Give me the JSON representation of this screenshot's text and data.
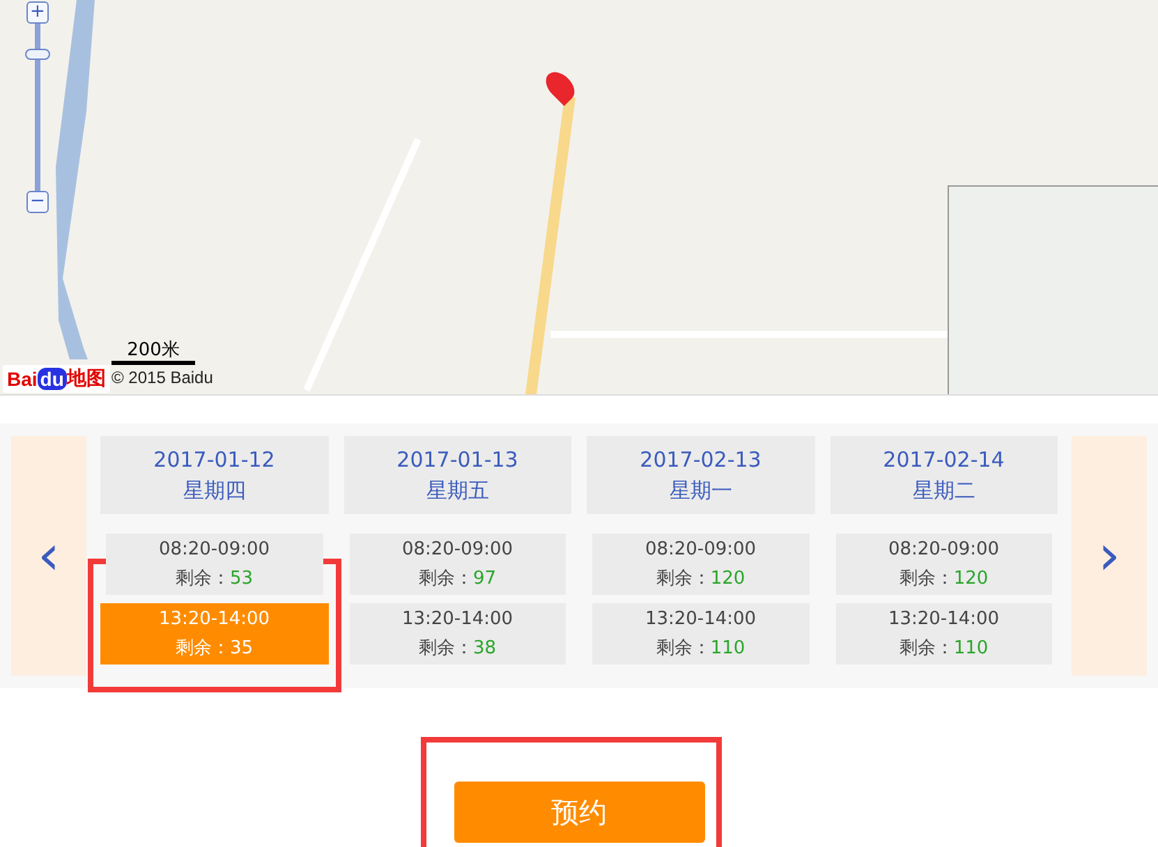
{
  "map": {
    "zoom": {
      "level": 0.85
    },
    "zoom_in": "+",
    "zoom_out": "−",
    "scale": "200米",
    "copyright": "© 2015 Baidu",
    "logo": {
      "left": "Bai",
      "mid": "du",
      "right": "地图"
    }
  },
  "schedule": {
    "prev": "‹",
    "next": "›",
    "days": [
      {
        "date": "2017-01-12",
        "weekday": "星期四",
        "slots": [
          {
            "time": "08:20-09:00",
            "remaining_label": "剩余：",
            "remaining": "53",
            "selected": false
          },
          {
            "time": "13:20-14:00",
            "remaining_label": "剩余：",
            "remaining": "35",
            "selected": true
          }
        ]
      },
      {
        "date": "2017-01-13",
        "weekday": "星期五",
        "slots": [
          {
            "time": "08:20-09:00",
            "remaining_label": "剩余：",
            "remaining": "97",
            "selected": false
          },
          {
            "time": "13:20-14:00",
            "remaining_label": "剩余：",
            "remaining": "38",
            "selected": false
          }
        ]
      },
      {
        "date": "2017-02-13",
        "weekday": "星期一",
        "slots": [
          {
            "time": "08:20-09:00",
            "remaining_label": "剩余：",
            "remaining": "120",
            "selected": false
          },
          {
            "time": "13:20-14:00",
            "remaining_label": "剩余：",
            "remaining": "110",
            "selected": false
          }
        ]
      },
      {
        "date": "2017-02-14",
        "weekday": "星期二",
        "slots": [
          {
            "time": "08:20-09:00",
            "remaining_label": "剩余：",
            "remaining": "120",
            "selected": false
          },
          {
            "time": "13:20-14:00",
            "remaining_label": "剩余：",
            "remaining": "110",
            "selected": false
          }
        ]
      }
    ]
  },
  "book_button": "预约"
}
